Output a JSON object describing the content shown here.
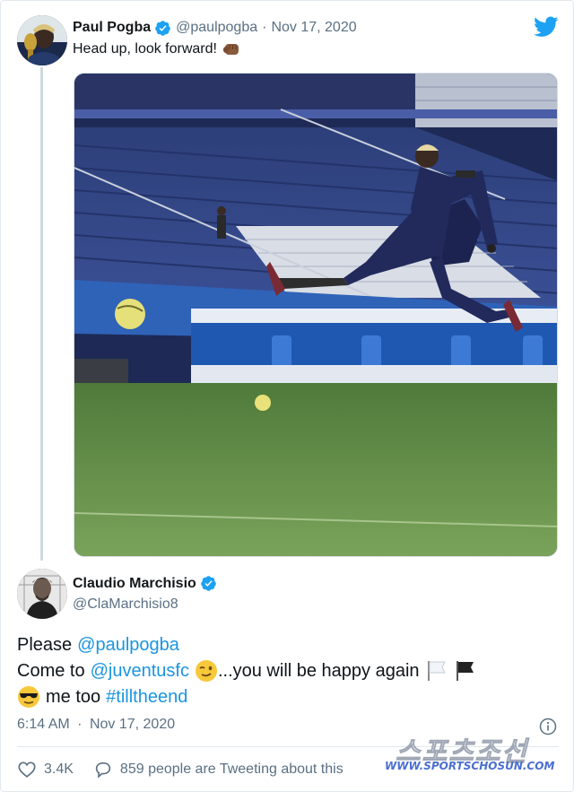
{
  "quoted_tweet": {
    "author_name": "Paul Pogba",
    "author_handle": "@paulpogba",
    "separator": "·",
    "date": "Nov 17, 2020",
    "text": "Head up, look forward!",
    "text_emoji": "fist-bump-emoji",
    "photo_description_icon": "football-photo"
  },
  "tweet": {
    "author_name": "Claudio Marchisio",
    "author_handle": "@ClaMarchisio8",
    "line1_word": "Please",
    "mention_pogba": "@paulpogba",
    "line2_word": "Come to",
    "mention_juventus": "@juventusfc",
    "line2_rest": "...you will be happy again",
    "line3_word": "me too",
    "hashtag": "#tilltheend",
    "time": "6:14 AM",
    "separator": "·",
    "date": "Nov 17, 2020"
  },
  "actions": {
    "likes": "3.4K",
    "replies_text": "859 people are Tweeting about this"
  },
  "watermark": {
    "url": "WWW.SPORTSCHOSUN.COM"
  },
  "icons": {
    "twitter": "twitter-bird-icon",
    "verified": "verified-badge-icon",
    "info": "info-icon",
    "like": "heart-icon",
    "reply": "reply-bubble-icon"
  },
  "colors": {
    "link": "#1b95e0",
    "muted": "#5b7083",
    "twitter_blue": "#1da1f2"
  }
}
